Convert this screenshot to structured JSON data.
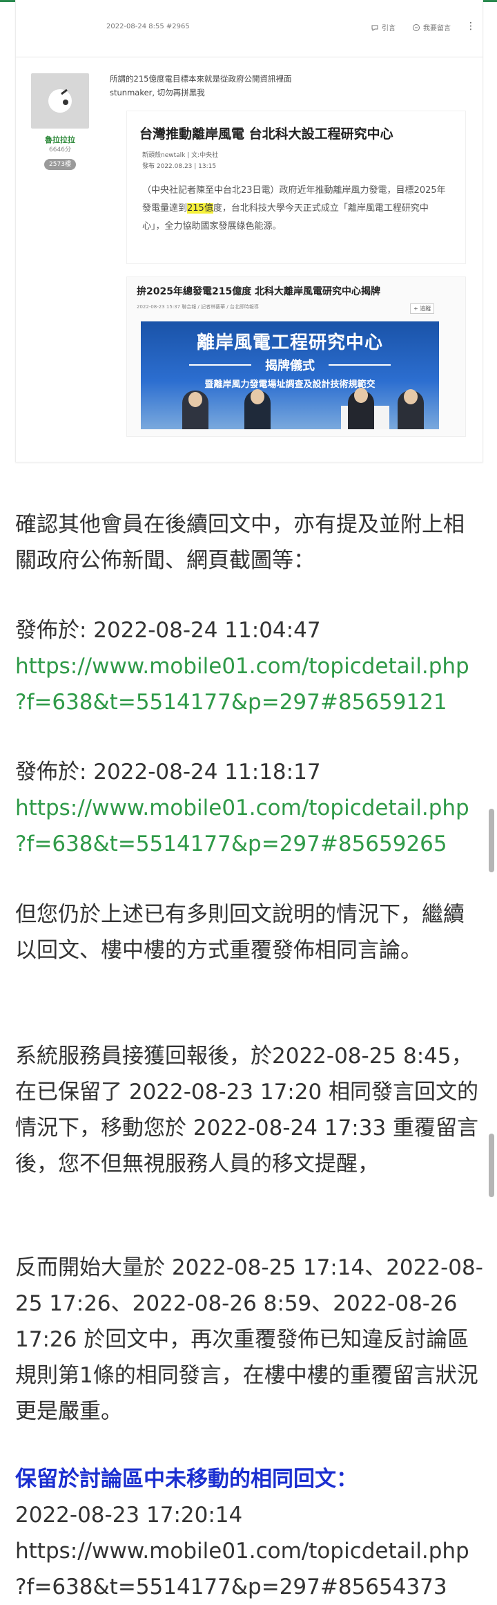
{
  "card": {
    "post_time": "2022-08-24 8:55 #2965",
    "actions": [
      {
        "label": "引言",
        "icon": "quote-icon"
      },
      {
        "label": "我要留言",
        "icon": "comment-icon"
      }
    ],
    "user": {
      "name": "魯拉拉拉",
      "score": "6646分",
      "floor": "2573樓"
    },
    "quote_line1": "所謂的215億度電目標本來就是從政府公開資訊裡面",
    "quote_line2": "stunmaker, 切勿再拼黑我",
    "news1": {
      "headline": "台灣推動離岸風電 台北科大設工程研究中心",
      "source": "新頭殼newtalk | 文:中央社",
      "date": "發布 2022.08.23 | 13:15",
      "body_pre": "（中央社記者陳至中台北23日電）政府近年推動離岸風力發電，目標2025年發電量達到",
      "body_mark": "215億",
      "body_post": "度，台北科技大學今天正式成立「離岸風電工程研究中心」，全力協助國家發展綠色能源。"
    },
    "news2": {
      "headline": "拚2025年總發電215億度 北科大離岸風電研究中心揭牌",
      "meta": "2022-08-23 15:37  聯合報 / 記者林藝華 / 台北即時報導",
      "subscribe": "+ 追蹤",
      "banner_title": "離岸風電工程研究中心",
      "banner_sub": "揭牌儀式",
      "banner_sub2": "暨離岸風力發電場址調查及設計技術規範交"
    }
  },
  "article": {
    "p1": "確認其他會員在後續回文中，亦有提及並附上相關政府公佈新聞、網頁截圖等：",
    "ref1_label": "發佈於: 2022-08-24 11:04:47",
    "ref1_url_a": "https://www.mobile01.com/topicdetail.php",
    "ref1_url_b": "?f=638&t=5514177&p=297#85659121",
    "ref2_label": "發佈於: 2022-08-24 11:18:17",
    "ref2_url_a": "https://www.mobile01.com/topicdetail.php",
    "ref2_url_b": "?f=638&t=5514177&p=297#85659265",
    "p2": "但您仍於上述已有多則回文說明的情況下，繼續以回文、樓中樓的方式重覆發佈相同言論。",
    "p3": "系統服務員接獲回報後，於2022-08-25 8:45，在已保留了 2022-08-23 17:20 相同發言回文的情況下，移動您於 2022-08-24 17:33 重覆留言後，您不但無視服務人員的移文提醒，",
    "p4": "反而開始大量於 2022-08-25 17:14、2022-08-25 17:26、2022-08-26 8:59、2022-08-26 17:26 於回文中，再次重覆發佈已知違反討論區規則第1條的相同發言，在樓中樓的重覆留言狀況更是嚴重。",
    "heading": "保留於討論區中未移動的相同回文：",
    "ref3_label": "2022-08-23 17:20:14",
    "ref3_url_a": "https://www.mobile01.com/topicdetail.php",
    "ref3_url_b": "?f=638&t=5514177&p=297#85654373"
  }
}
